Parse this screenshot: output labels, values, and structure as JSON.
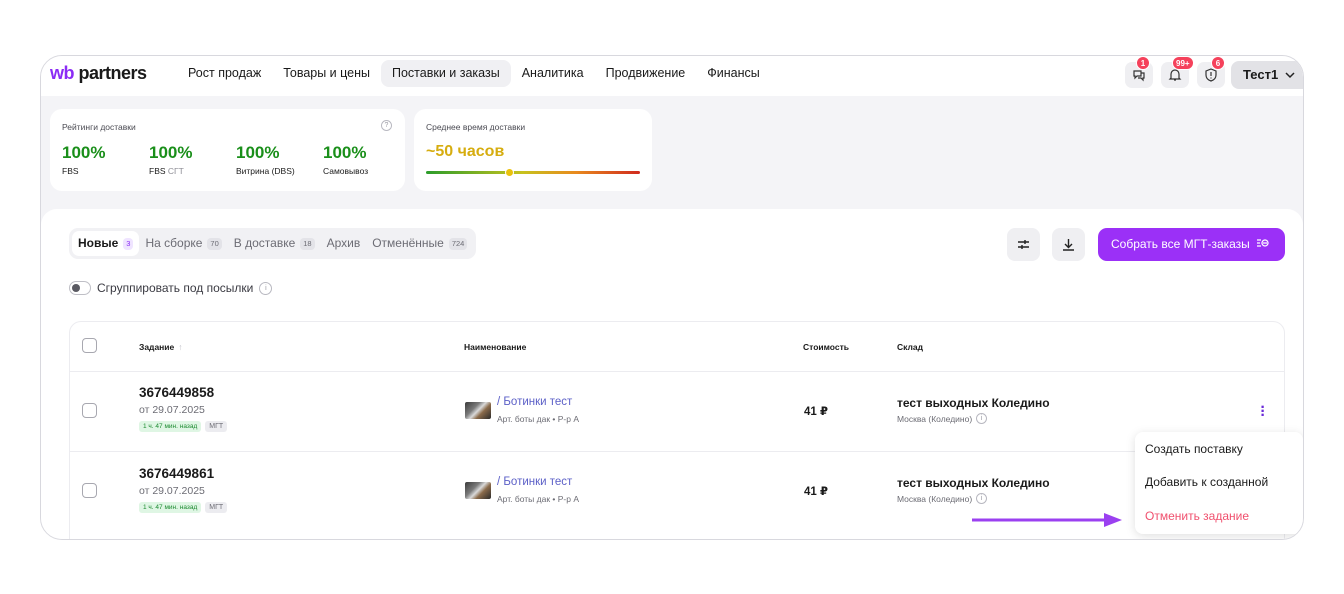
{
  "logo": {
    "wb": "wb",
    "rest": " partners"
  },
  "nav": [
    {
      "label": "Рост продаж",
      "active": false
    },
    {
      "label": "Товары и цены",
      "active": false
    },
    {
      "label": "Поставки и заказы",
      "active": true
    },
    {
      "label": "Аналитика",
      "active": false
    },
    {
      "label": "Продвижение",
      "active": false
    },
    {
      "label": "Финансы",
      "active": false
    }
  ],
  "header_icons": {
    "chat_badge": "1",
    "bell_badge": "99+",
    "shield_badge": "6"
  },
  "user": {
    "name": "Тест1"
  },
  "ratings": {
    "title": "Рейтинги доставки",
    "items": [
      {
        "value": "100%",
        "label": "FBS",
        "suffix": ""
      },
      {
        "value": "100%",
        "label": "FBS",
        "suffix": " СГТ"
      },
      {
        "value": "100%",
        "label": "Витрина (DBS)",
        "suffix": ""
      },
      {
        "value": "100%",
        "label": "Самовывоз",
        "suffix": ""
      }
    ]
  },
  "avg_delivery": {
    "title": "Среднее время доставки",
    "value": "~50 часов",
    "level": 0.39
  },
  "tabs": [
    {
      "label": "Новые",
      "count": "3",
      "active": true
    },
    {
      "label": "На сборке",
      "count": "70",
      "active": false
    },
    {
      "label": "В доставке",
      "count": "18",
      "active": false
    },
    {
      "label": "Архив",
      "count": "",
      "active": false
    },
    {
      "label": "Отменённые",
      "count": "724",
      "active": false
    }
  ],
  "collect_button": "Собрать все МГТ-заказы",
  "group_toggle": "Сгруппировать под посылки",
  "table": {
    "headers": {
      "task": "Задание",
      "name": "Наименование",
      "price": "Стоимость",
      "warehouse": "Склад"
    },
    "rows": [
      {
        "id": "3676449858",
        "date": "от 29.07.2025",
        "time_tag": "1 ч. 47 мин. назад",
        "type_tag": "МГТ",
        "product": "/ Ботинки тест",
        "article": "Арт. боты дак • Р-р А",
        "price": "41 ₽",
        "warehouse": "тест выходных Коледино",
        "city": "Москва (Коледино)"
      },
      {
        "id": "3676449861",
        "date": "от 29.07.2025",
        "time_tag": "1 ч. 47 мин. назад",
        "type_tag": "МГТ",
        "product": "/ Ботинки тест",
        "article": "Арт. боты дак • Р-р А",
        "price": "41 ₽",
        "warehouse": "тест выходных Коледино",
        "city": "Москва (Коледино)"
      }
    ]
  },
  "context_menu": {
    "create_supply": "Создать поставку",
    "add_to_created": "Добавить к созданной",
    "cancel_task": "Отменить задание"
  },
  "colors": {
    "accent": "#9b30f7",
    "success": "#1a8f1a",
    "danger": "#f0506e",
    "warning": "#d6ad10"
  }
}
